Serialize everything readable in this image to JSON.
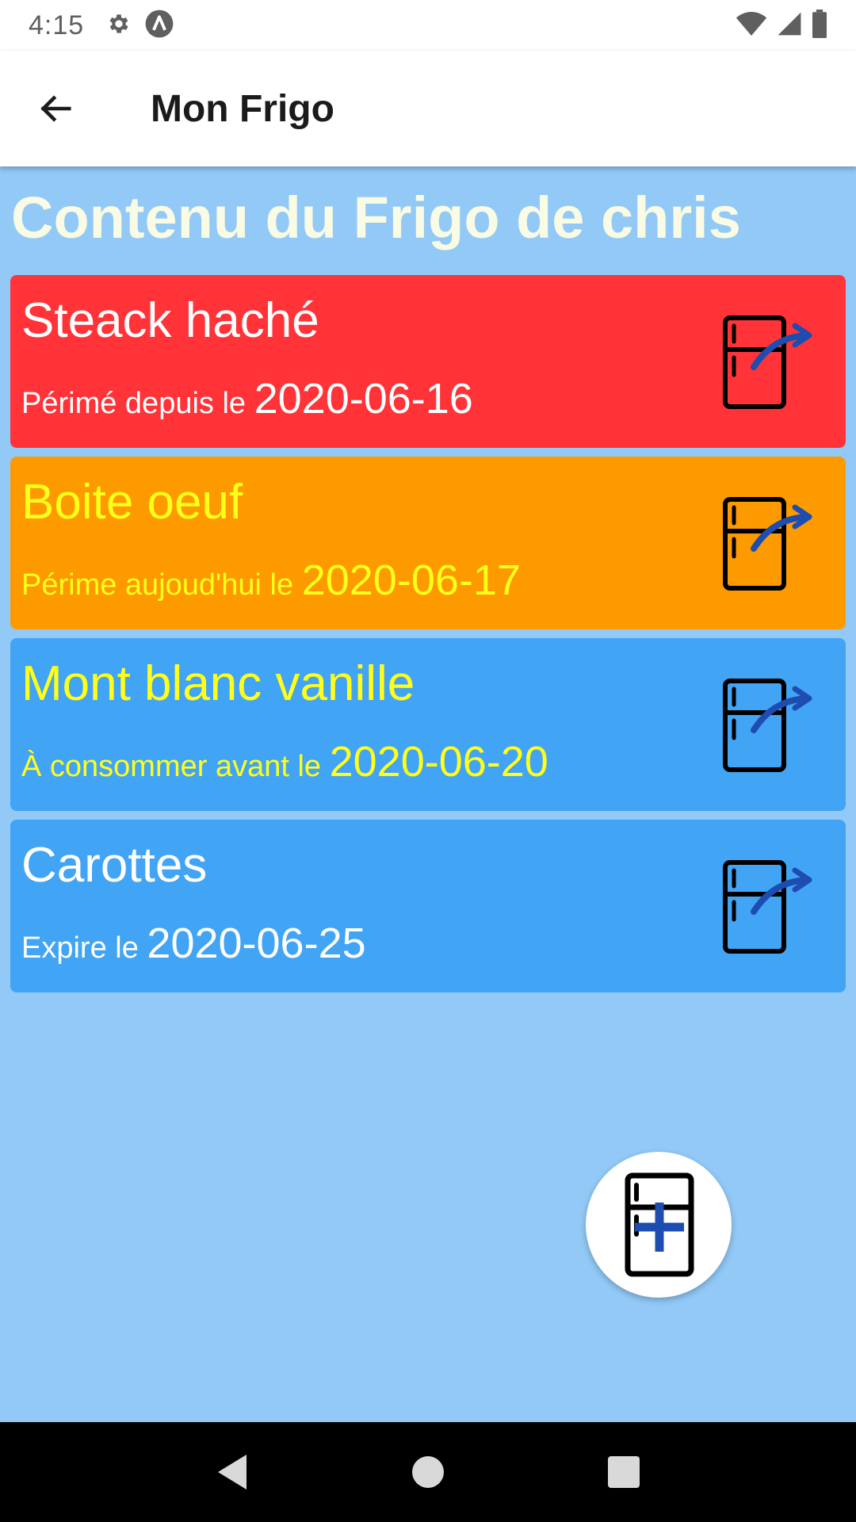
{
  "status_bar": {
    "time": "4:15",
    "icons_left": [
      "gear-icon",
      "app-notification-icon"
    ],
    "icons_right": [
      "wifi-icon",
      "signal-icon",
      "battery-icon"
    ]
  },
  "app_bar": {
    "back_icon": "arrow-left-icon",
    "title": "Mon Frigo"
  },
  "page": {
    "heading": "Contenu du Frigo de chris"
  },
  "items": [
    {
      "name": "Steack haché",
      "prefix": "Périmé depuis le ",
      "date": "2020-06-16",
      "bg": "#ff3338",
      "color": "#ffffff",
      "action_icon": "remove-from-fridge-icon"
    },
    {
      "name": "Boite oeuf",
      "prefix": "Périme aujoud'hui le ",
      "date": "2020-06-17",
      "bg": "#fd9a00",
      "color": "#ffff1a",
      "action_icon": "remove-from-fridge-icon"
    },
    {
      "name": "Mont blanc vanille",
      "prefix": "À consommer avant le ",
      "date": "2020-06-20",
      "bg": "#42a4f4",
      "color": "#ffff1a",
      "action_icon": "remove-from-fridge-icon"
    },
    {
      "name": "Carottes",
      "prefix": "Expire le ",
      "date": "2020-06-25",
      "bg": "#42a4f4",
      "color": "#ffffff",
      "action_icon": "remove-from-fridge-icon"
    }
  ],
  "fab": {
    "icon": "add-to-fridge-icon"
  },
  "nav_bar": {
    "icons": [
      "nav-back-icon",
      "nav-home-icon",
      "nav-recents-icon"
    ]
  },
  "colors": {
    "background": "#92c9f6",
    "heading_text": "#f9fbe4",
    "icon_arrow": "#1d4db0"
  }
}
